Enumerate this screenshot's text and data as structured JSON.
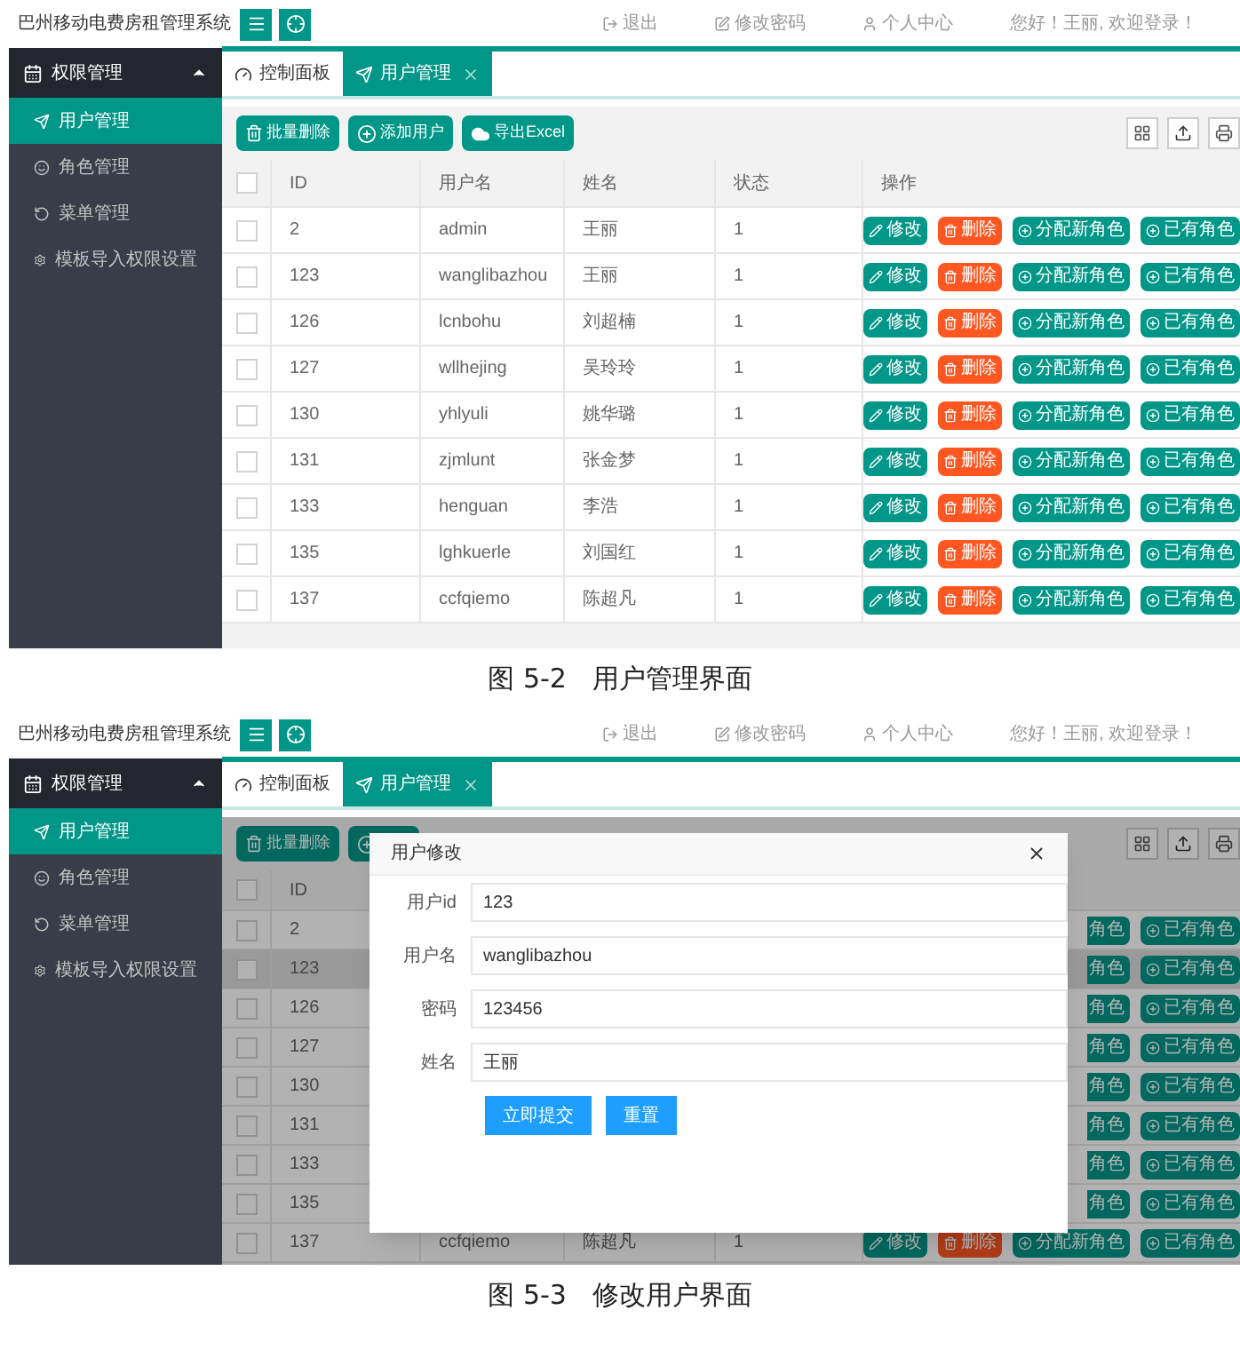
{
  "figures": [
    {
      "screen": {
        "app_title": "巴州移动电费房租管理系统",
        "top_links": [
          {
            "label": "退出"
          },
          {
            "label": "修改密码"
          },
          {
            "label": "个人中心"
          }
        ],
        "greeting": "您好！王丽, 欢迎登录！",
        "sidebar": {
          "group": "权限管理",
          "expanded": true,
          "items": [
            {
              "label": "用户管理",
              "selected": true
            },
            {
              "label": "角色管理",
              "selected": false
            },
            {
              "label": "菜单管理",
              "selected": false
            },
            {
              "label": "模板导入权限设置",
              "selected": false
            }
          ]
        },
        "tabs": [
          {
            "label": "控制面板",
            "selected": false,
            "closable": false
          },
          {
            "label": "用户管理",
            "selected": true,
            "closable": true
          }
        ],
        "toolbar": [
          {
            "label": "批量删除",
            "kind": "delete"
          },
          {
            "label": "添加用户",
            "kind": "add"
          },
          {
            "label": "导出Excel",
            "kind": "export"
          }
        ],
        "table": {
          "all_checked": false,
          "columns": [
            "ID",
            "用户名",
            "姓名",
            "状态",
            "操作"
          ],
          "rows": [
            {
              "checked": false,
              "id": "2",
              "username": "admin",
              "name": "王丽",
              "status": "1",
              "actions": [
                {
                  "kind": "edit",
                  "label": "修改"
                },
                {
                  "kind": "delete",
                  "label": "删除"
                },
                {
                  "kind": "assign",
                  "label": "分配新角色"
                },
                {
                  "kind": "roles",
                  "label": "已有角色"
                }
              ]
            },
            {
              "checked": false,
              "id": "123",
              "username": "wanglibazhou",
              "name": "王丽",
              "status": "1",
              "actions": [
                {
                  "kind": "edit",
                  "label": "修改"
                },
                {
                  "kind": "delete",
                  "label": "删除"
                },
                {
                  "kind": "assign",
                  "label": "分配新角色"
                },
                {
                  "kind": "roles",
                  "label": "已有角色"
                }
              ]
            },
            {
              "checked": false,
              "id": "126",
              "username": "lcnbohu",
              "name": "刘超楠",
              "status": "1",
              "actions": [
                {
                  "kind": "edit",
                  "label": "修改"
                },
                {
                  "kind": "delete",
                  "label": "删除"
                },
                {
                  "kind": "assign",
                  "label": "分配新角色"
                },
                {
                  "kind": "roles",
                  "label": "已有角色"
                }
              ]
            },
            {
              "checked": false,
              "id": "127",
              "username": "wllhejing",
              "name": "吴玲玲",
              "status": "1",
              "actions": [
                {
                  "kind": "edit",
                  "label": "修改"
                },
                {
                  "kind": "delete",
                  "label": "删除"
                },
                {
                  "kind": "assign",
                  "label": "分配新角色"
                },
                {
                  "kind": "roles",
                  "label": "已有角色"
                }
              ]
            },
            {
              "checked": false,
              "id": "130",
              "username": "yhlyuli",
              "name": "姚华璐",
              "status": "1",
              "actions": [
                {
                  "kind": "edit",
                  "label": "修改"
                },
                {
                  "kind": "delete",
                  "label": "删除"
                },
                {
                  "kind": "assign",
                  "label": "分配新角色"
                },
                {
                  "kind": "roles",
                  "label": "已有角色"
                }
              ]
            },
            {
              "checked": false,
              "id": "131",
              "username": "zjmlunt",
              "name": "张金梦",
              "status": "1",
              "actions": [
                {
                  "kind": "edit",
                  "label": "修改"
                },
                {
                  "kind": "delete",
                  "label": "删除"
                },
                {
                  "kind": "assign",
                  "label": "分配新角色"
                },
                {
                  "kind": "roles",
                  "label": "已有角色"
                }
              ]
            },
            {
              "checked": false,
              "id": "133",
              "username": "henguan",
              "name": "李浩",
              "status": "1",
              "actions": [
                {
                  "kind": "edit",
                  "label": "修改"
                },
                {
                  "kind": "delete",
                  "label": "删除"
                },
                {
                  "kind": "assign",
                  "label": "分配新角色"
                },
                {
                  "kind": "roles",
                  "label": "已有角色"
                }
              ]
            },
            {
              "checked": false,
              "id": "135",
              "username": "lghkuerle",
              "name": "刘国红",
              "status": "1",
              "actions": [
                {
                  "kind": "edit",
                  "label": "修改"
                },
                {
                  "kind": "delete",
                  "label": "删除"
                },
                {
                  "kind": "assign",
                  "label": "分配新角色"
                },
                {
                  "kind": "roles",
                  "label": "已有角色"
                }
              ]
            },
            {
              "checked": false,
              "id": "137",
              "username": "ccfqiemo",
              "name": "陈超凡",
              "status": "1",
              "actions": [
                {
                  "kind": "edit",
                  "label": "修改"
                },
                {
                  "kind": "delete",
                  "label": "删除"
                },
                {
                  "kind": "assign",
                  "label": "分配新角色"
                },
                {
                  "kind": "roles",
                  "label": "已有角色"
                }
              ]
            }
          ]
        }
      },
      "caption": "图 5-2   用户管理界面"
    },
    {
      "screen": {
        "app_title": "巴州移动电费房租管理系统",
        "top_links": [
          {
            "label": "退出"
          },
          {
            "label": "修改密码"
          },
          {
            "label": "个人中心"
          }
        ],
        "greeting": "您好！王丽, 欢迎登录！",
        "sidebar": {
          "group": "权限管理",
          "expanded": true,
          "items": [
            {
              "label": "用户管理",
              "selected": true
            },
            {
              "label": "角色管理",
              "selected": false
            },
            {
              "label": "菜单管理",
              "selected": false
            },
            {
              "label": "模板导入权限设置",
              "selected": false
            }
          ]
        },
        "tabs": [
          {
            "label": "控制面板",
            "selected": false,
            "closable": false
          },
          {
            "label": "用户管理",
            "selected": true,
            "closable": true
          }
        ],
        "toolbar": [
          {
            "label": "批量删除",
            "kind": "delete"
          },
          {
            "kind": "add"
          }
        ],
        "table": {
          "all_checked": false,
          "columns": [
            "ID"
          ],
          "rows": [
            {
              "checked": false,
              "highlighted": false,
              "id": "2",
              "actions": [
                {
                  "kind": "assign",
                  "label": "角色",
                  "cut": true
                },
                {
                  "kind": "roles",
                  "label": "已有角色"
                }
              ]
            },
            {
              "checked": false,
              "highlighted": true,
              "id": "123",
              "actions": [
                {
                  "kind": "assign",
                  "label": "角色",
                  "cut": true
                },
                {
                  "kind": "roles",
                  "label": "已有角色"
                }
              ]
            },
            {
              "checked": false,
              "highlighted": false,
              "id": "126",
              "actions": [
                {
                  "kind": "assign",
                  "label": "角色",
                  "cut": true
                },
                {
                  "kind": "roles",
                  "label": "已有角色"
                }
              ]
            },
            {
              "checked": false,
              "highlighted": false,
              "id": "127",
              "actions": [
                {
                  "kind": "assign",
                  "label": "角色",
                  "cut": true
                },
                {
                  "kind": "roles",
                  "label": "已有角色"
                }
              ]
            },
            {
              "checked": false,
              "highlighted": false,
              "id": "130",
              "actions": [
                {
                  "kind": "assign",
                  "label": "角色",
                  "cut": true
                },
                {
                  "kind": "roles",
                  "label": "已有角色"
                }
              ]
            },
            {
              "checked": false,
              "highlighted": false,
              "id": "131",
              "actions": [
                {
                  "kind": "assign",
                  "label": "角色",
                  "cut": true
                },
                {
                  "kind": "roles",
                  "label": "已有角色"
                }
              ]
            },
            {
              "checked": false,
              "highlighted": false,
              "id": "133",
              "actions": [
                {
                  "kind": "assign",
                  "label": "角色",
                  "cut": true
                },
                {
                  "kind": "roles",
                  "label": "已有角色"
                }
              ]
            },
            {
              "checked": false,
              "highlighted": false,
              "id": "135",
              "actions": [
                {
                  "kind": "assign",
                  "label": "角色",
                  "cut": true
                },
                {
                  "kind": "roles",
                  "label": "已有角色"
                }
              ]
            },
            {
              "checked": false,
              "highlighted": false,
              "id": "137",
              "username": "ccfqiemo",
              "name": "陈超凡",
              "status": "1",
              "actions": [
                {
                  "kind": "edit",
                  "label": "修改"
                },
                {
                  "kind": "delete",
                  "label": "删除"
                },
                {
                  "kind": "assign",
                  "label": "分配新角色"
                },
                {
                  "kind": "roles",
                  "label": "已有角色"
                }
              ]
            }
          ]
        },
        "modal": {
          "title": "用户修改",
          "fields": [
            {
              "label": "用户id",
              "value": "123"
            },
            {
              "label": "用户名",
              "value": "wanglibazhou"
            },
            {
              "label": "密码",
              "value": "123456"
            },
            {
              "label": "姓名",
              "value": "王丽"
            }
          ],
          "buttons": [
            {
              "label": "立即提交"
            },
            {
              "label": "重置"
            }
          ]
        }
      },
      "caption": "图 5-3   修改用户界面"
    }
  ]
}
